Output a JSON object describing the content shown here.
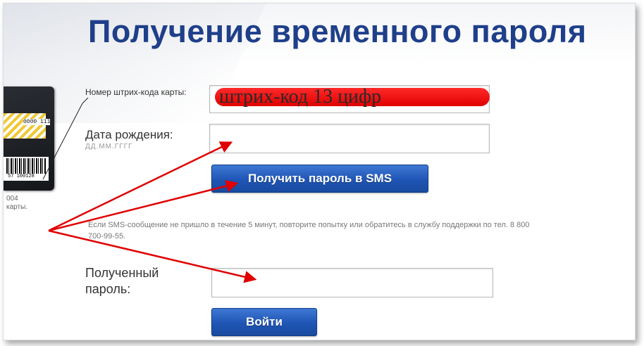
{
  "title": "Получение временного пароля",
  "card": {
    "stripe_number": "0000 111",
    "barcode_number": "57 100128",
    "caption_line1": "004",
    "caption_line2": "карты."
  },
  "barcode_field": {
    "label": "Номер штрих-кода карты:",
    "overlay_text": "штрих-код 13 цифр"
  },
  "birth_field": {
    "label": "Дата рождения:",
    "hint": "ДД.ММ.ГГГГ"
  },
  "sms_button": {
    "label": "Получить пароль в SMS"
  },
  "note": "Если SMS-сообщение не пришло в течение 5 минут, повторите попытку или обратитесь в службу поддержки по тел. 8 800 700-99-55.",
  "password_field": {
    "label": "Полученный пароль:"
  },
  "login_button": {
    "label": "Войти"
  },
  "colors": {
    "title": "#1f3f8a",
    "button": "#1f55b5",
    "arrow": "#e00000"
  }
}
